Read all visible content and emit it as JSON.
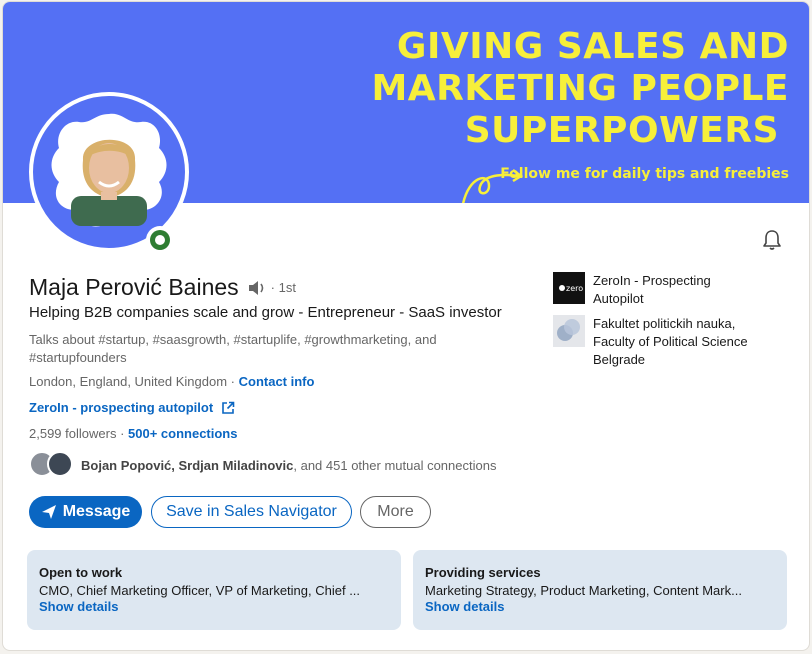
{
  "banner": {
    "line1": "GIVING SALES AND",
    "line2": "MARKETING PEOPLE",
    "line3": "SUPERPOWERS",
    "subtitle": "Follow me for daily tips and freebies",
    "bg_color": "#5470f4",
    "text_color": "#f7ef3a"
  },
  "profile": {
    "name": "Maja Perović Baines",
    "degree": "· 1st",
    "headline": "Helping B2B companies scale and grow - Entrepreneur - SaaS investor",
    "talks_about": "Talks about #startup, #saasgrowth, #startuplife, #growthmarketing, and #startupfounders",
    "location": "London, England, United Kingdom",
    "location_sep": " · ",
    "contact_info": "Contact info",
    "website": "ZeroIn - prospecting autopilot",
    "followers": "2,599 followers",
    "followers_sep": " · ",
    "connections": "500+ connections",
    "mutual_names": "Bojan Popović, Srdjan Miladinovic",
    "mutual_rest": ", and 451 other mutual connections"
  },
  "actions": {
    "message": "Message",
    "sales_navigator": "Save in Sales Navigator",
    "more": "More"
  },
  "sidebar": {
    "items": [
      {
        "label": "ZeroIn - Prospecting Autopilot",
        "logo_text": "zero"
      },
      {
        "label": "Fakultet politickih nauka, Faculty of Political Science Belgrade"
      }
    ]
  },
  "info_boxes": [
    {
      "title": "Open to work",
      "desc": "CMO, Chief Marketing Officer, VP of Marketing, Chief ...",
      "link": "Show details"
    },
    {
      "title": "Providing services",
      "desc": "Marketing Strategy, Product Marketing, Content Mark...",
      "link": "Show details"
    }
  ],
  "colors": {
    "accent": "#0a66c2",
    "open_to_work": "#2e7d32",
    "info_box_bg": "#dde7f1"
  },
  "icons": {
    "bell": "bell-icon",
    "speaker": "speaker-icon",
    "external": "external-link-icon",
    "send": "send-icon"
  }
}
